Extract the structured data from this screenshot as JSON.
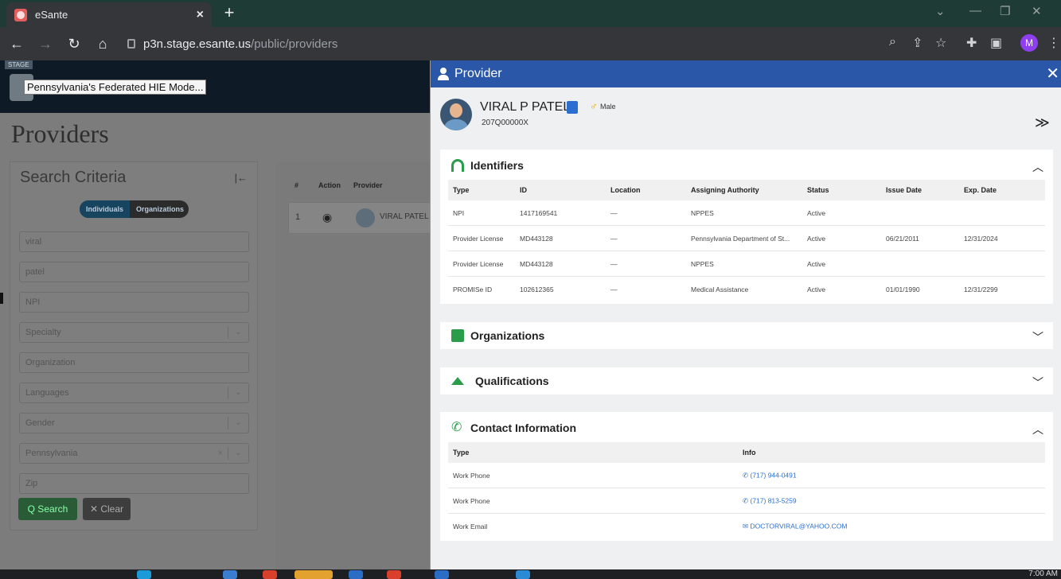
{
  "browser": {
    "tab_title": "eSante",
    "url_host": "p3n.stage.esante.us",
    "url_path": "/public/providers",
    "profile_initial": "M"
  },
  "app": {
    "stage_label": "STAGE",
    "tooltip": "Pennsylvania's Federated HIE Mode...",
    "page_title": "Providers",
    "search": {
      "title": "Search Criteria",
      "toggle": [
        "Individuals",
        "Organizations"
      ],
      "fields": [
        {
          "value": "viral"
        },
        {
          "value": "patel"
        },
        {
          "value": "NPI"
        },
        {
          "value": "Specialty",
          "dropdown": true
        },
        {
          "value": "Organization"
        },
        {
          "value": "Languages",
          "dropdown": true
        },
        {
          "value": "Gender",
          "dropdown": true
        },
        {
          "value": "Pennsylvania",
          "dropdown": true,
          "clear": true
        },
        {
          "value": "Zip"
        }
      ],
      "search_label": "Q Search",
      "clear_label": "✕ Clear"
    },
    "results": {
      "headers": [
        "#",
        "Action",
        "Provider"
      ],
      "rows": [
        {
          "num": "1",
          "name": "VIRAL PATEL"
        }
      ]
    }
  },
  "drawer": {
    "title": "Provider",
    "provider_name": "VIRAL P PATEL",
    "gender": "Male",
    "taxonomy": "207Q00000X",
    "identifiers": {
      "title": "Identifiers",
      "headers": [
        "Type",
        "ID",
        "Location",
        "Assigning Authority",
        "Status",
        "Issue Date",
        "Exp. Date"
      ],
      "rows": [
        [
          "NPI",
          "1417169541",
          "—",
          "NPPES",
          "Active",
          "",
          ""
        ],
        [
          "Provider License",
          "MD443128",
          "—",
          "Pennsylvania Department of St...",
          "Active",
          "06/21/2011",
          "12/31/2024"
        ],
        [
          "Provider License",
          "MD443128",
          "—",
          "NPPES",
          "Active",
          "",
          ""
        ],
        [
          "PROMISe ID",
          "102612365",
          "—",
          "Medical Assistance",
          "Active",
          "01/01/1990",
          "12/31/2299"
        ]
      ]
    },
    "organizations": {
      "title": "Organizations"
    },
    "qualifications": {
      "title": "Qualifications"
    },
    "contact": {
      "title": "Contact Information",
      "headers": [
        "Type",
        "Info"
      ],
      "rows": [
        [
          "Work Phone",
          "(717) 944-0491"
        ],
        [
          "Work Phone",
          "(717) 813-5259"
        ],
        [
          "Work Email",
          "DOCTORVIRAL@YAHOO.COM"
        ]
      ]
    }
  },
  "taskbar": {
    "clock": "7:00 AM"
  }
}
